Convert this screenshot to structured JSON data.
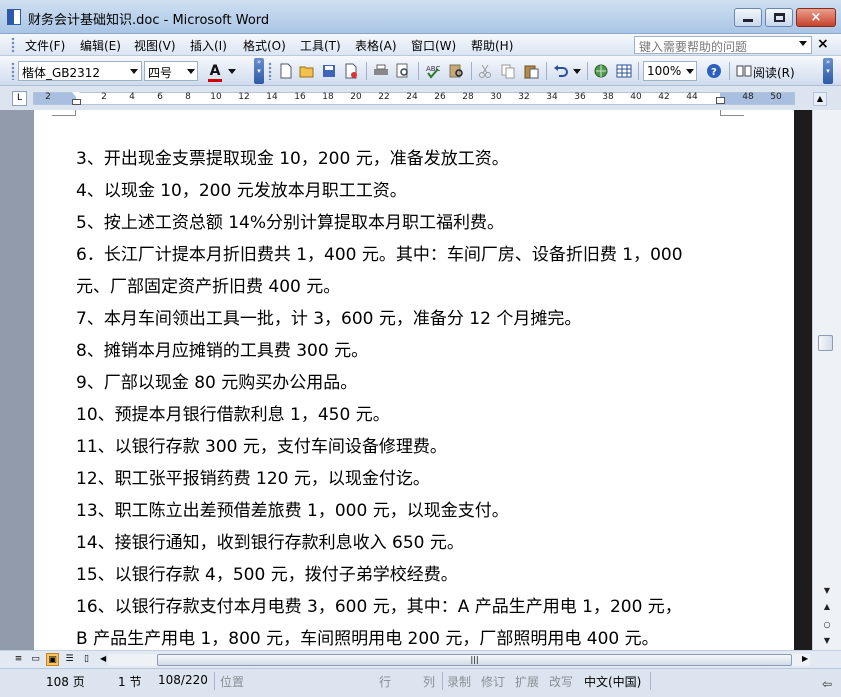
{
  "window": {
    "title": "财务会计基础知识.doc - Microsoft Word",
    "minimize_label": "",
    "restore_label": "",
    "close_label": "×"
  },
  "menubar": {
    "items": [
      "文件(F)",
      "编辑(E)",
      "视图(V)",
      "插入(I)",
      "格式(O)",
      "工具(T)",
      "表格(A)",
      "窗口(W)",
      "帮助(H)"
    ],
    "help_placeholder": "键入需要帮助的问题",
    "close_doc": "×"
  },
  "toolbar": {
    "font_name": "楷体_GB2312",
    "font_size": "四号",
    "font_color_label": "A",
    "font_color": "#d40000",
    "zoom": "100%",
    "read_label": "阅读(R)",
    "icons": [
      "new-icon",
      "open-icon",
      "save-icon",
      "permission-icon",
      "print-icon",
      "print-preview-icon",
      "spelling-icon",
      "research-icon",
      "cut-icon",
      "copy-icon",
      "paste-icon",
      "undo-icon",
      "hyperlink-icon",
      "table-icon",
      "help-icon",
      "read-icon"
    ]
  },
  "ruler": {
    "labels": [
      "2",
      "2",
      "4",
      "6",
      "8",
      "10",
      "12",
      "14",
      "16",
      "18",
      "20",
      "22",
      "24",
      "26",
      "28",
      "30",
      "32",
      "34",
      "36",
      "38",
      "40",
      "42",
      "44",
      "48",
      "50"
    ]
  },
  "document": {
    "lines": [
      "3、开出现金支票提取现金 10，200 元，准备发放工资。",
      "4、以现金 10，200 元发放本月职工工资。",
      "5、按上述工资总额 14%分别计算提取本月职工福利费。",
      "6．长江厂计提本月折旧费共 1，400 元。其中：车间厂房、设备折旧费 1，000",
      "元、厂部固定资产折旧费 400 元。",
      "7、本月车间领出工具一批，计 3，600 元，准备分 12 个月摊完。",
      "8、摊销本月应摊销的工具费 300 元。",
      "9、厂部以现金 80 元购买办公用品。",
      "10、预提本月银行借款利息 1，450 元。",
      "11、以银行存款 300 元，支付车间设备修理费。",
      "12、职工张平报销药费 120 元，以现金付讫。",
      "13、职工陈立出差预借差旅费 1，000 元，以现金支付。",
      "14、接银行通知，收到银行存款利息收入 650 元。",
      "15、以银行存款 4，500 元，拨付子弟学校经费。",
      "16、以银行存款支付本月电费 3，600 元，其中：A 产品生产用电 1，200 元，",
      "B 产品生产用电 1，800 元，车间照明用电 200 元，厂部照明用电 400 元。"
    ]
  },
  "statusbar": {
    "page": "108 页",
    "section": "1 节",
    "page_of": "108/220",
    "position": "位置",
    "line": "行",
    "column": "列",
    "rec": "录制",
    "trk": "修订",
    "ext": "扩展",
    "ovr": "改写",
    "language": "中文(中国)"
  }
}
